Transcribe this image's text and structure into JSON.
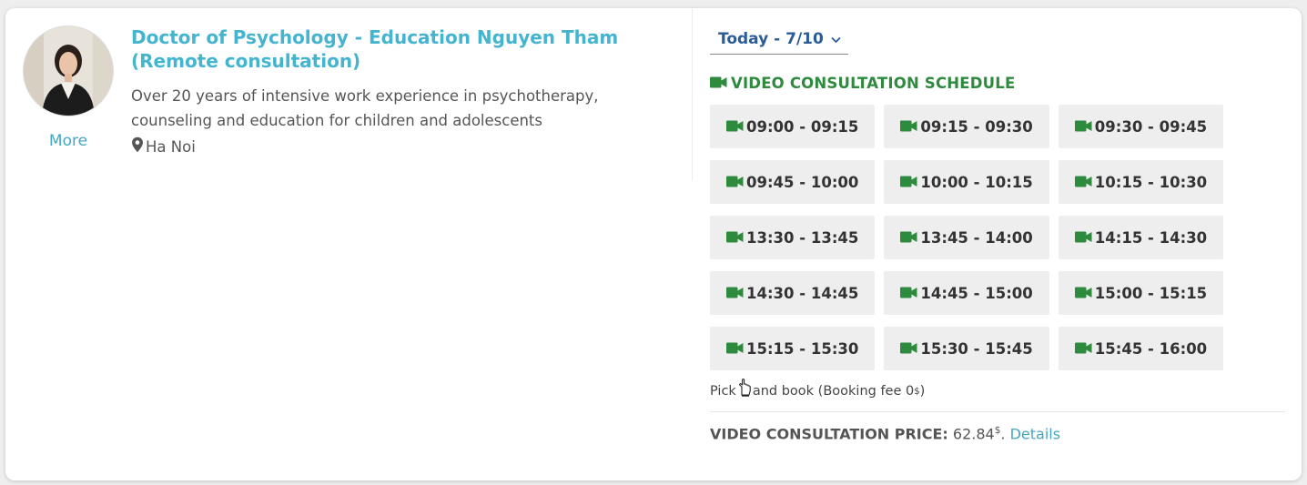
{
  "doctor": {
    "name": "Doctor of Psychology - Education Nguyen Tham (Remote consultation)",
    "description": "Over 20 years of intensive work experience in psychotherapy, counseling and education for children and adolescents",
    "location": "Ha Noi",
    "more_label": "More"
  },
  "schedule": {
    "date_label": "Today - 7/10",
    "title": "VIDEO CONSULTATION SCHEDULE",
    "rows": [
      [
        "09:00 - 09:15",
        "09:15 - 09:30",
        "09:30 - 09:45"
      ],
      [
        "09:45 - 10:00",
        "10:00 - 10:15",
        "10:15 - 10:30"
      ],
      [
        "13:30 - 13:45",
        "13:45 - 14:00",
        "14:15 - 14:30"
      ],
      [
        "14:30 - 14:45",
        "14:45 - 15:00",
        "15:00 - 15:15"
      ],
      [
        "15:15 - 15:30",
        "15:30 - 15:45",
        "15:45 - 16:00"
      ]
    ],
    "hint_pick": "Pick",
    "hint_book": "and book (Booking fee 0",
    "hint_currency": "$",
    "hint_close": ")"
  },
  "price": {
    "label": "VIDEO CONSULTATION PRICE:",
    "value": "62.84",
    "currency": "$",
    "period": ".",
    "details_label": "Details"
  },
  "colors": {
    "accent": "#45b5cf",
    "green": "#2e8a3c",
    "date_blue": "#2a5d98",
    "slot_bg": "#eeeeee"
  },
  "icons": [
    "video-camera-icon",
    "map-pin-icon",
    "chevron-down-icon",
    "hand-pointer-icon"
  ]
}
